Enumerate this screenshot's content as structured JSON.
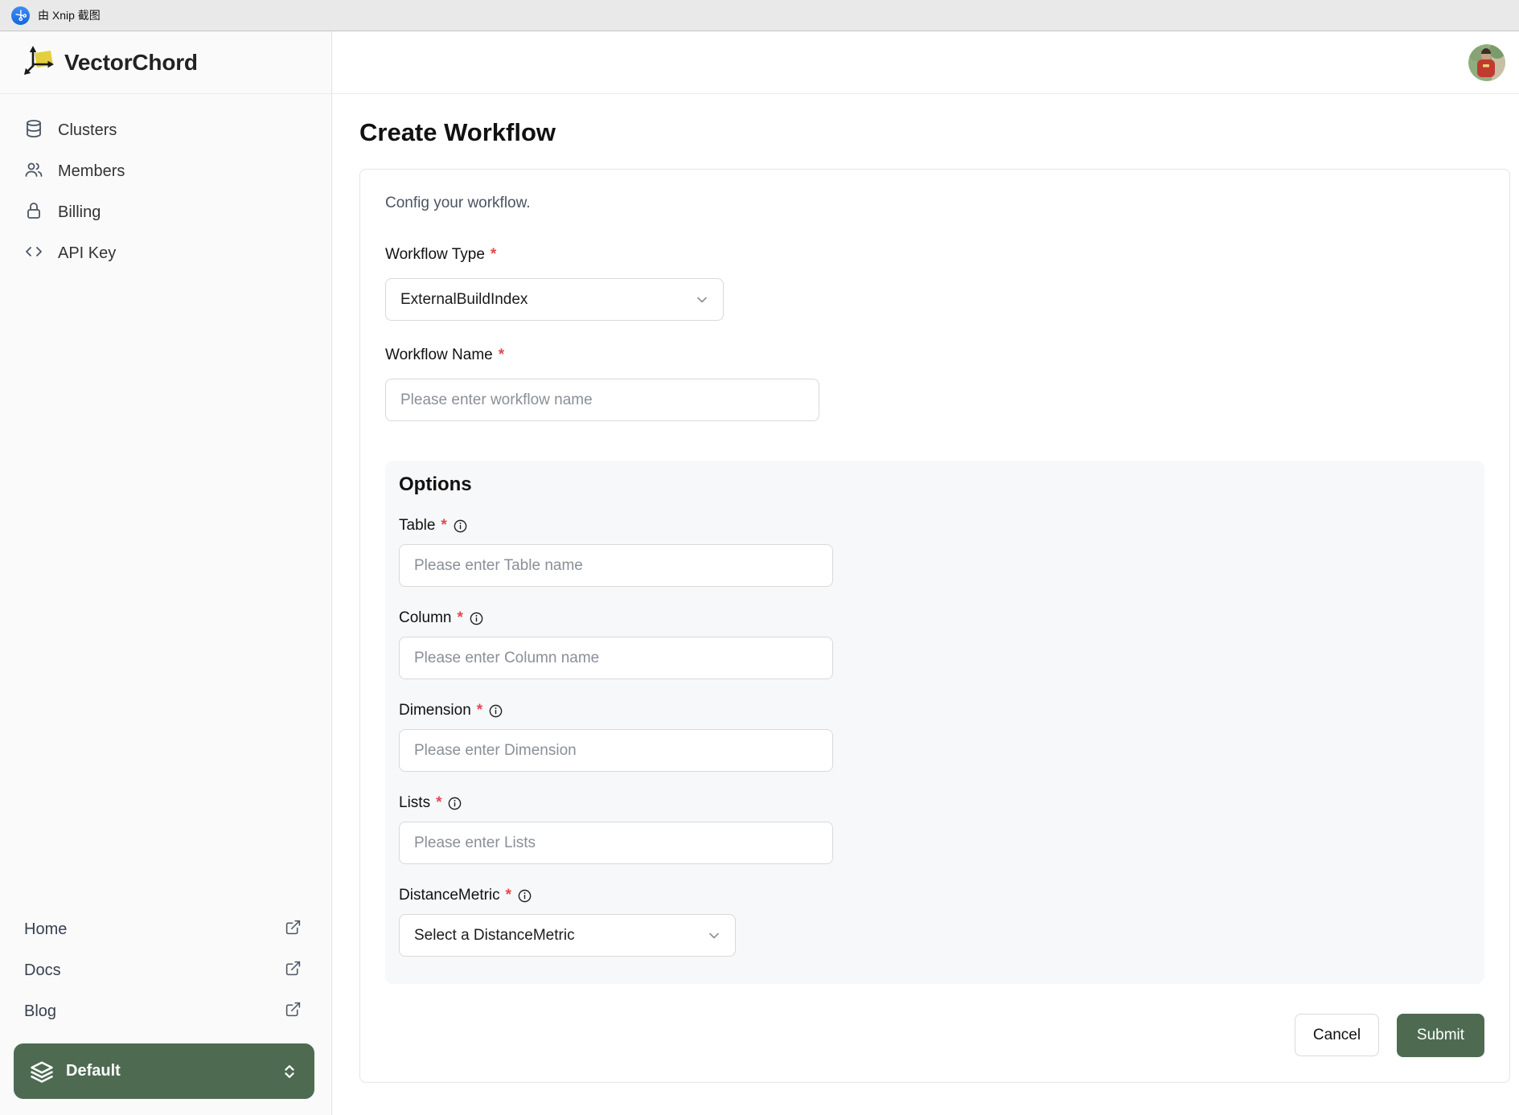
{
  "xnip_bar": {
    "label": "由 Xnip 截图"
  },
  "brand": {
    "name": "VectorChord"
  },
  "sidebar": {
    "nav": [
      {
        "label": "Clusters",
        "icon": "database-icon"
      },
      {
        "label": "Members",
        "icon": "users-icon"
      },
      {
        "label": "Billing",
        "icon": "lock-icon"
      },
      {
        "label": "API Key",
        "icon": "code-icon"
      }
    ],
    "links": [
      {
        "label": "Home",
        "icon": "external-link-icon"
      },
      {
        "label": "Docs",
        "icon": "external-link-icon"
      },
      {
        "label": "Blog",
        "icon": "external-link-icon"
      }
    ],
    "project_selector": {
      "label": "Default",
      "icon": "layers-icon"
    }
  },
  "main": {
    "title": "Create Workflow",
    "required_marker": "*",
    "card": {
      "description": "Config your workflow.",
      "workflow_type": {
        "label": "Workflow Type",
        "value": "ExternalBuildIndex"
      },
      "workflow_name": {
        "label": "Workflow Name",
        "placeholder": "Please enter workflow name"
      },
      "options": {
        "heading": "Options",
        "fields": [
          {
            "label": "Table",
            "placeholder": "Please enter Table name",
            "type": "input"
          },
          {
            "label": "Column",
            "placeholder": "Please enter Column name",
            "type": "input"
          },
          {
            "label": "Dimension",
            "placeholder": "Please enter Dimension",
            "type": "input"
          },
          {
            "label": "Lists",
            "placeholder": "Please enter Lists",
            "type": "input"
          },
          {
            "label": "DistanceMetric",
            "placeholder": "Select a DistanceMetric",
            "type": "select"
          }
        ]
      },
      "actions": {
        "cancel": "Cancel",
        "submit": "Submit"
      }
    }
  },
  "colors": {
    "accent_green": "#4e6b52",
    "required_red": "#e5484d"
  }
}
